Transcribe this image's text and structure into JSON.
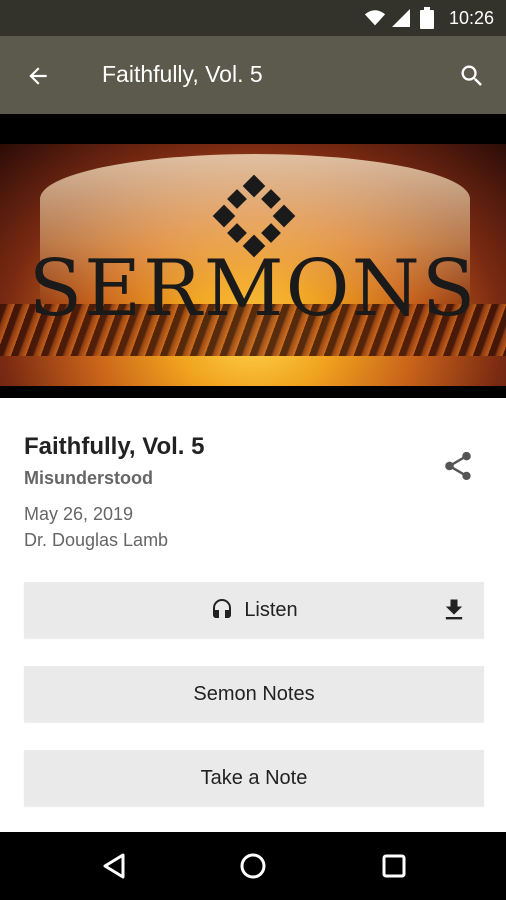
{
  "status_bar": {
    "time": "10:26",
    "icons": [
      "wifi-icon",
      "signal-icon",
      "battery-icon"
    ]
  },
  "app_bar": {
    "title": "Faithfully, Vol. 5",
    "back_icon": "arrow-back-icon",
    "search_icon": "search-icon"
  },
  "hero": {
    "text": "SERMONS",
    "logo_icon": "cross-logo-icon"
  },
  "sermon": {
    "title": "Faithfully, Vol. 5",
    "series": "Misunderstood",
    "date": "May 26, 2019",
    "speaker": "Dr. Douglas Lamb",
    "share_icon": "share-icon"
  },
  "buttons": {
    "listen": {
      "label": "Listen",
      "icon": "headphones-icon",
      "download_icon": "download-icon"
    },
    "notes": {
      "label": "Semon Notes"
    },
    "take_note": {
      "label": "Take a Note"
    }
  },
  "nav": {
    "back_icon": "nav-back-icon",
    "home_icon": "nav-home-icon",
    "recents_icon": "nav-recents-icon"
  },
  "colors": {
    "status_bar": "#33332b",
    "app_bar": "#5b5a4c",
    "button_bg": "#eaeaea",
    "nav_bar": "#000000"
  }
}
